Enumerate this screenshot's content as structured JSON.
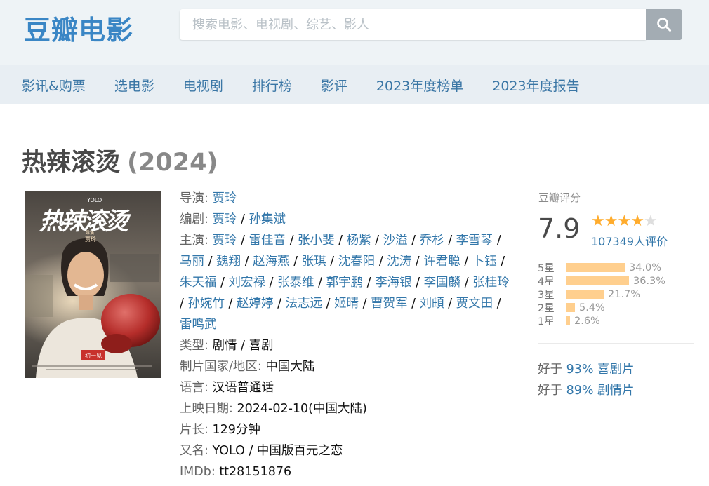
{
  "header": {
    "logo": "豆瓣电影",
    "search_placeholder": "搜索电影、电视剧、综艺、影人",
    "nav": [
      "影讯&购票",
      "选电影",
      "电视剧",
      "排行榜",
      "影评",
      "2023年度榜单",
      "2023年度报告"
    ]
  },
  "movie": {
    "title": "热辣滚烫",
    "year": "(2024)",
    "poster_text": {
      "yolo": "YOLO",
      "calligraphy": "热辣滚烫",
      "director_tag": "导演",
      "director": "贾玲",
      "badge": "初一见"
    },
    "labels": {
      "director": "导演: ",
      "writer": "编剧: ",
      "cast": "主演: ",
      "genre": "类型: ",
      "country": "制片国家/地区: ",
      "language": "语言: ",
      "release": "上映日期: ",
      "runtime": "片长: ",
      "aka": "又名: ",
      "imdb": "IMDb: "
    },
    "directors": [
      "贾玲"
    ],
    "writers": [
      "贾玲",
      "孙集斌"
    ],
    "cast": [
      "贾玲",
      "雷佳音",
      "张小斐",
      "杨紫",
      "沙溢",
      "乔杉",
      "李雪琴",
      "马丽",
      "魏翔",
      "赵海燕",
      "张琪",
      "沈春阳",
      "沈涛",
      "许君聪",
      "卜钰",
      "朱天福",
      "刘宏禄",
      "张泰维",
      "郭宇鹏",
      "李海银",
      "李国麟",
      "张桂玲",
      "孙婉竹",
      "赵婷婷",
      "法志远",
      "姬晴",
      "曹贺军",
      "刘頔",
      "贾文田",
      "雷鸣武"
    ],
    "genre": [
      "剧情",
      "喜剧"
    ],
    "country": "中国大陆",
    "language": "汉语普通话",
    "release_date": "2024-02-10(中国大陆)",
    "runtime": "129分钟",
    "aka": "YOLO / 中国版百元之恋",
    "imdb": "tt28151876"
  },
  "rating": {
    "label": "豆瓣评分",
    "score": "7.9",
    "stars_filled": 4,
    "stars_total": 5,
    "votes": "107349人评价",
    "distribution": [
      {
        "label": "5星",
        "percent": "34.0%",
        "value": 34.0
      },
      {
        "label": "4星",
        "percent": "36.3%",
        "value": 36.3
      },
      {
        "label": "3星",
        "percent": "21.7%",
        "value": 21.7
      },
      {
        "label": "2星",
        "percent": "5.4%",
        "value": 5.4
      },
      {
        "label": "1星",
        "percent": "2.6%",
        "value": 2.6
      }
    ],
    "better_than": [
      {
        "prefix": "好于 ",
        "link": "93% 喜剧片"
      },
      {
        "prefix": "好于 ",
        "link": "89% 剧情片"
      }
    ]
  }
}
